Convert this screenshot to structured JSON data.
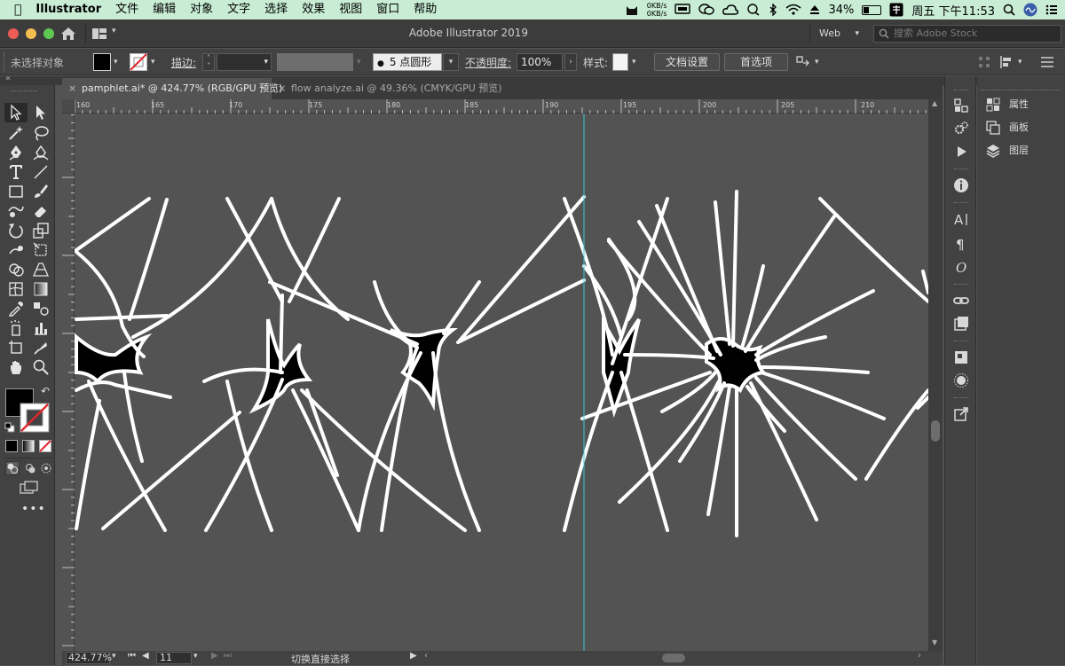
{
  "menubar": {
    "apple": "",
    "app_name": "Illustrator",
    "items": [
      "文件",
      "编辑",
      "对象",
      "文字",
      "选择",
      "效果",
      "视图",
      "窗口",
      "帮助"
    ],
    "net_up": "0KB/s",
    "net_down": "0KB/s",
    "battery": "34%",
    "clock": "周五 下午11:53"
  },
  "titlebar": {
    "title": "Adobe Illustrator 2019",
    "workspace": "Web",
    "stock_search_placeholder": "搜索 Adobe Stock"
  },
  "controlbar": {
    "selection_state": "未选择对象",
    "stroke_label": "描边:",
    "brush_value": "5 点圆形",
    "opacity_label": "不透明度:",
    "opacity_value": "100%",
    "style_label": "样式:",
    "doc_setup_button": "文档设置",
    "preferences_button": "首选项"
  },
  "tabs": [
    {
      "label": "pamphlet.ai* @ 424.77% (RGB/GPU 预览)",
      "close": "×",
      "active": true
    },
    {
      "label": "flow analyze.ai @ 49.36% (CMYK/GPU 预览)",
      "close": "×",
      "active": false
    }
  ],
  "ruler": {
    "h_ticks": [
      "160",
      "165",
      "170",
      "175",
      "180",
      "185",
      "190",
      "195",
      "200",
      "205",
      "210"
    ]
  },
  "statusbar": {
    "zoom": "424.77%",
    "artboard": "11",
    "message": "切换直接选择"
  },
  "properties_panel": {
    "items": [
      "属性",
      "画板",
      "图层"
    ]
  },
  "colors": {
    "menubar_bg": "#c8ecd4",
    "ui_dark": "#424242",
    "canvas": "#535353",
    "guide": "#37c8d8",
    "fill_black": "#000000",
    "stroke_white": "#ffffff"
  }
}
